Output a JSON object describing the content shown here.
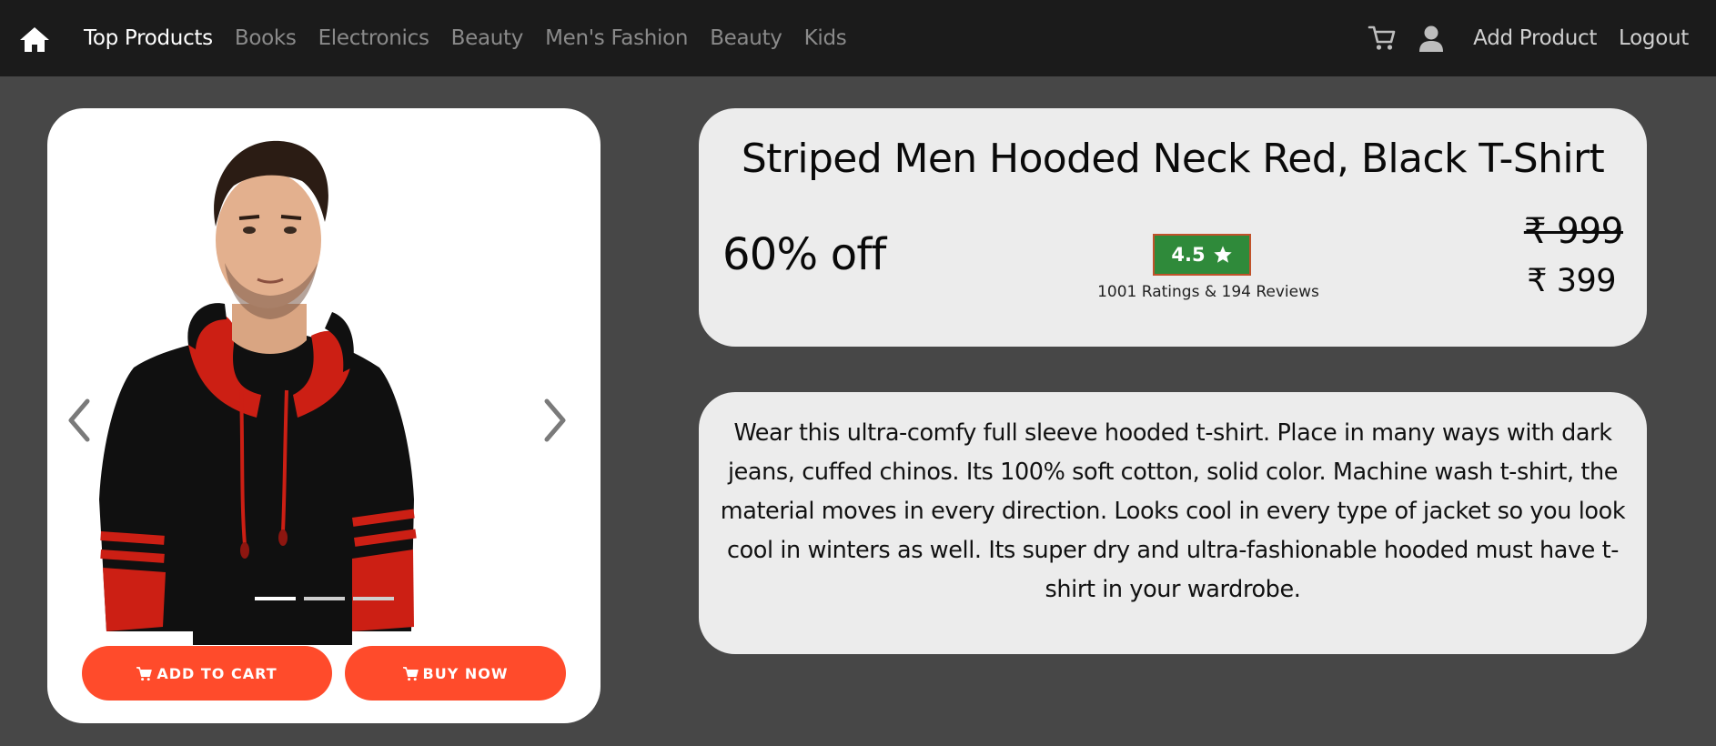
{
  "nav": {
    "home_icon": "home-icon",
    "links": [
      {
        "label": "Top Products",
        "active": true
      },
      {
        "label": "Books"
      },
      {
        "label": "Electronics"
      },
      {
        "label": "Beauty"
      },
      {
        "label": "Men's Fashion"
      },
      {
        "label": "Beauty"
      },
      {
        "label": "Kids"
      }
    ],
    "cart_icon": "cart-icon",
    "user_icon": "user-icon",
    "add_product_label": "Add Product",
    "logout_label": "Logout"
  },
  "product": {
    "image": "hooded-tshirt-photo",
    "carousel": {
      "slide_count": 3,
      "active_index": 0
    },
    "add_to_cart_label": "ADD TO CART",
    "buy_now_label": "BUY NOW",
    "title": "Striped Men Hooded Neck Red, Black T-Shirt",
    "discount": "60% off",
    "rating": "4.5",
    "rating_summary": "1001 Ratings & 194 Reviews",
    "mrp": "₹ 999",
    "price": "₹ 399",
    "description": "Wear this ultra-comfy full sleeve hooded t-shirt. Place in many ways with dark jeans, cuffed chinos. Its 100% soft cotton, solid color. Machine wash t-shirt, the material moves in every direction. Looks cool in every type of jacket so you look cool in winters as well. Its super dry and ultra-fashionable hooded must have t-shirt in your wardrobe."
  },
  "colors": {
    "navbar_bg": "#1b1b1b",
    "page_bg": "#474747",
    "button_bg": "#ff4b2b",
    "rating_bg": "#2f8a3a",
    "card_bg": "#ececec"
  }
}
